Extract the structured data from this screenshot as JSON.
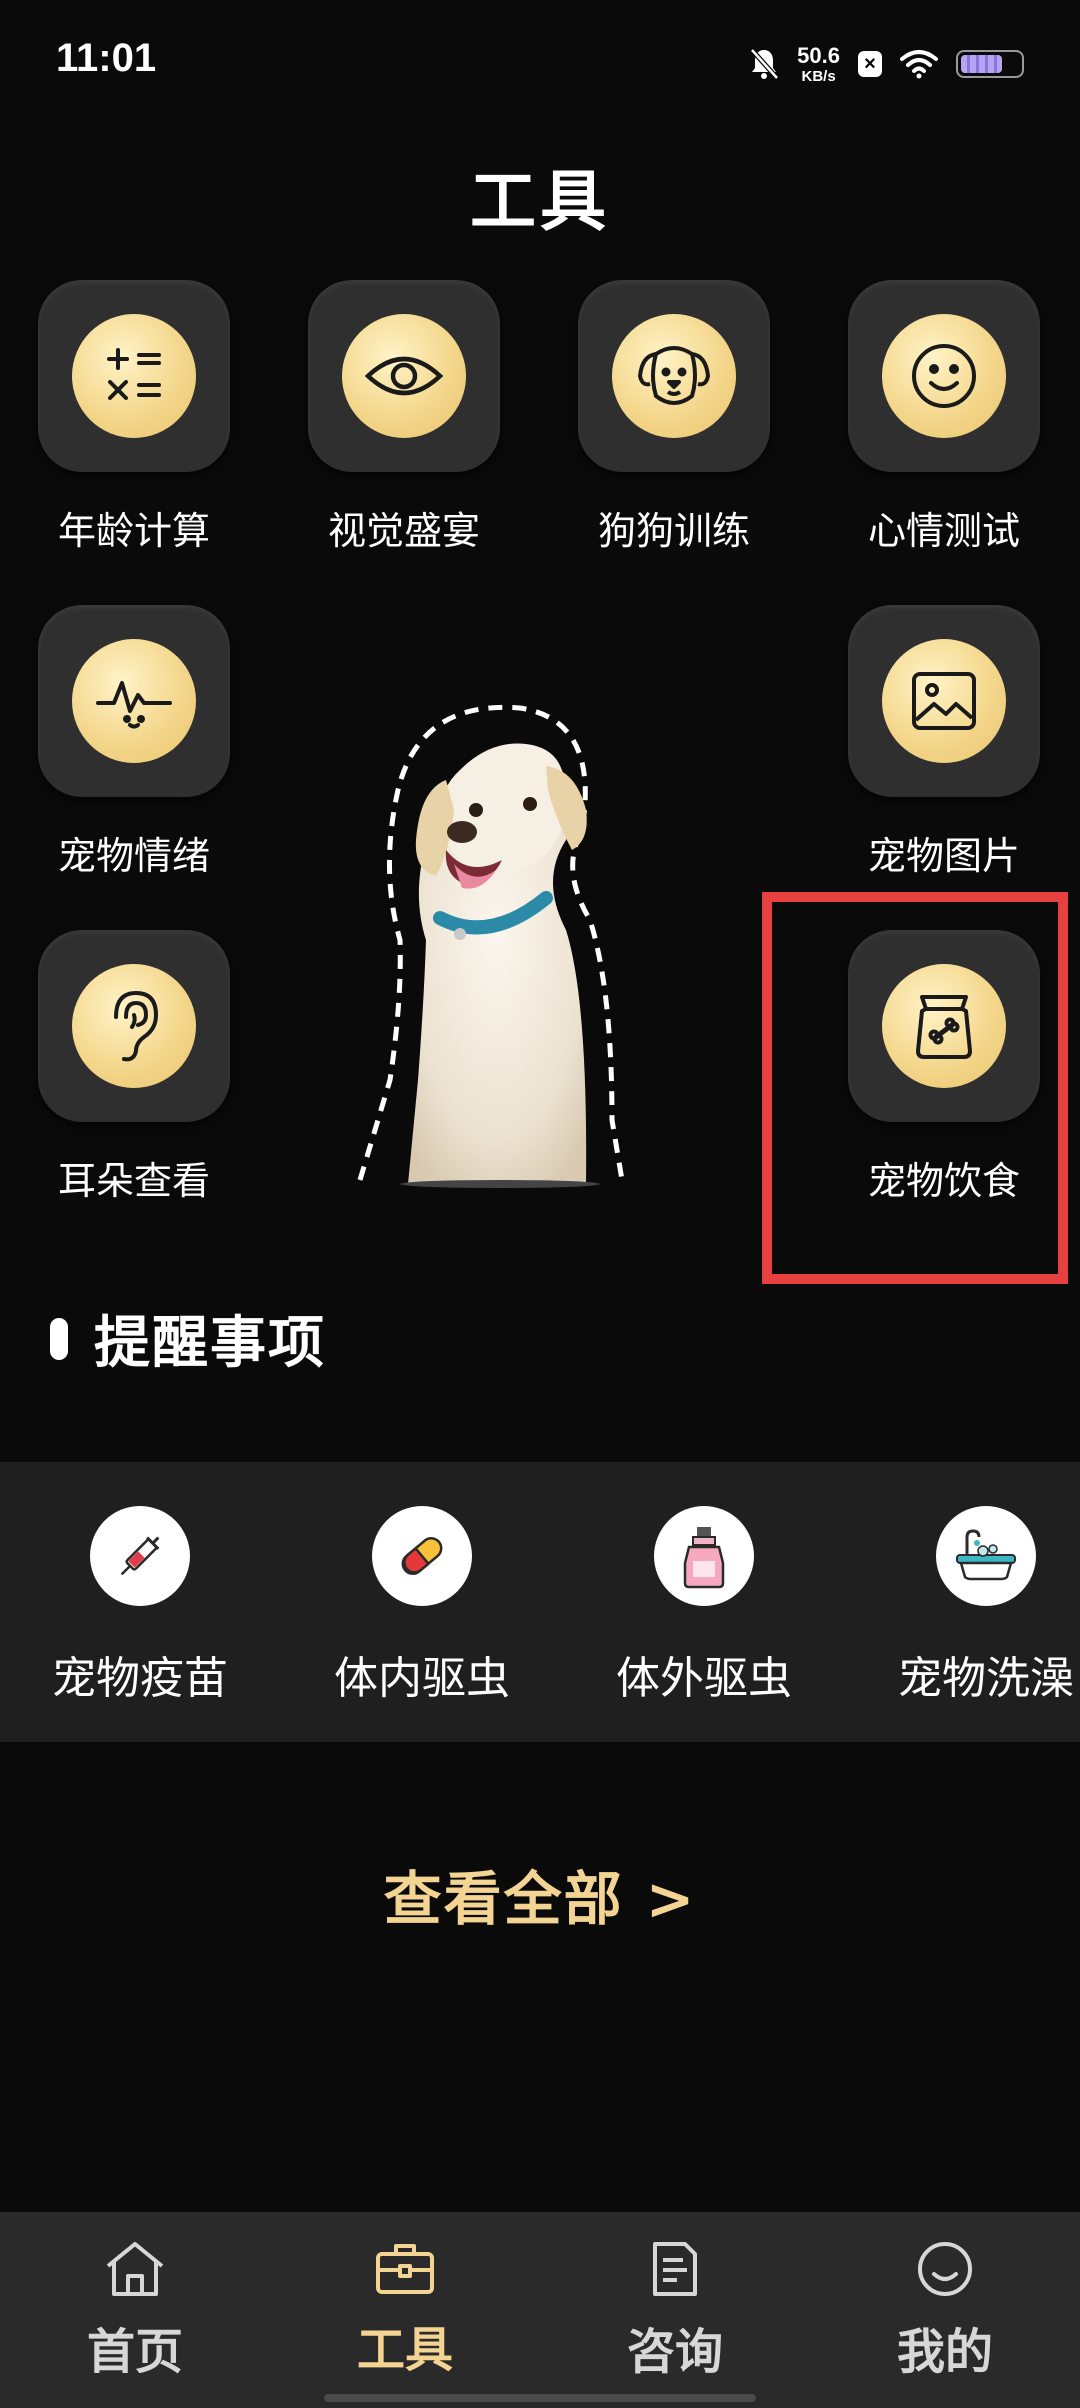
{
  "status_bar": {
    "time": "11:01",
    "net_speed_value": "50.6",
    "net_speed_unit": "KB/s",
    "x_badge": "×",
    "icons": [
      "bell-off-icon",
      "x-app-icon",
      "wifi-icon",
      "battery-icon"
    ],
    "battery_level": 0.7
  },
  "page_title": "工具",
  "tools": [
    {
      "label": "年龄计算",
      "icon": "calculator-icon"
    },
    {
      "label": "视觉盛宴",
      "icon": "eye-icon"
    },
    {
      "label": "狗狗训练",
      "icon": "dog-face-icon"
    },
    {
      "label": "心情测试",
      "icon": "smiley-icon"
    },
    {
      "label": "宠物情绪",
      "icon": "emotion-wave-icon"
    },
    {
      "label": "宠物图片",
      "icon": "image-icon"
    },
    {
      "label": "耳朵查看",
      "icon": "ear-icon"
    },
    {
      "label": "宠物饮食",
      "icon": "food-bag-icon"
    }
  ],
  "highlight_color": "#e8403f",
  "reminders": {
    "title": "提醒事项",
    "items": [
      {
        "label": "宠物疫苗",
        "icon": "syringe-icon"
      },
      {
        "label": "体内驱虫",
        "icon": "pill-icon"
      },
      {
        "label": "体外驱虫",
        "icon": "spray-bottle-icon"
      },
      {
        "label": "宠物洗澡",
        "icon": "bathtub-icon"
      }
    ],
    "view_all": "查看全部 >"
  },
  "bottom_nav": [
    {
      "label": "首页",
      "icon": "home-icon",
      "active": false
    },
    {
      "label": "工具",
      "icon": "toolbox-icon",
      "active": true
    },
    {
      "label": "咨询",
      "icon": "document-icon",
      "active": false
    },
    {
      "label": "我的",
      "icon": "profile-smile-icon",
      "active": false
    }
  ],
  "colors": {
    "background": "#0a0a0a",
    "accent_gold": "#f3d493",
    "tile_bg": "#2f2f2f",
    "nav_bg": "#2a2a2a"
  }
}
